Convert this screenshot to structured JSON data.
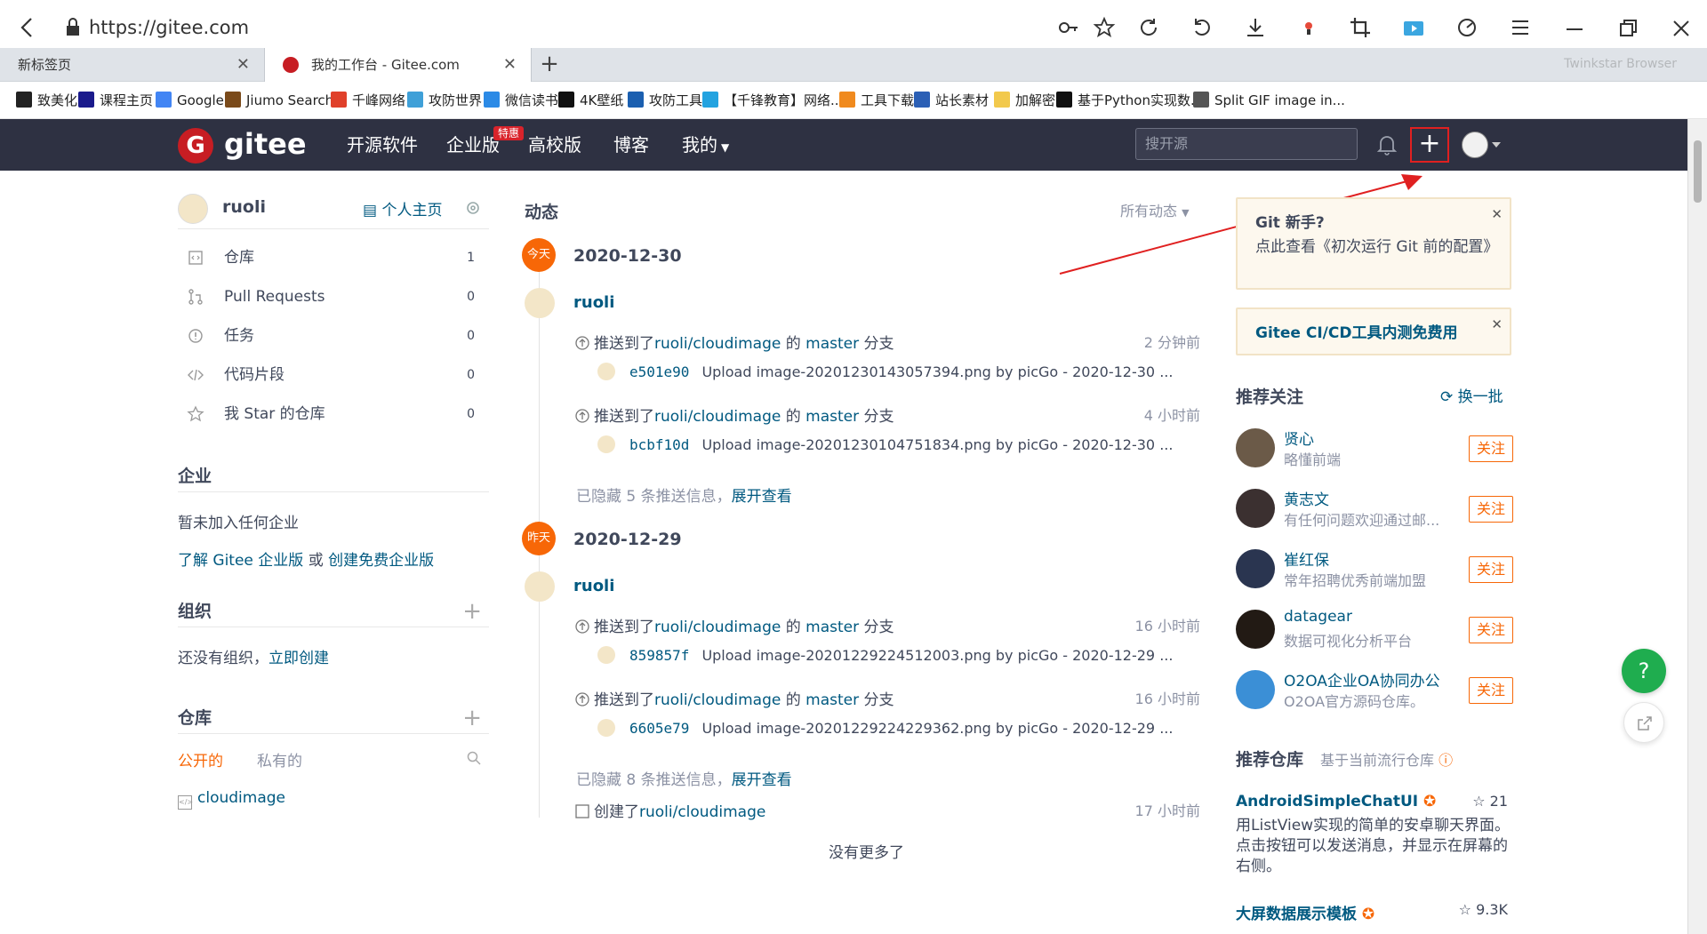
{
  "browser": {
    "url": "https://gitee.com",
    "brand": "Twinkstar Browser",
    "tabs": [
      {
        "label": "新标签页",
        "active": false
      },
      {
        "label": "我的工作台 - Gitee.com",
        "active": true
      }
    ],
    "bookmarks": [
      {
        "label": "致美化",
        "icon": "x-icon",
        "color": "#222"
      },
      {
        "label": "课程主页",
        "icon": "wh-icon",
        "color": "#1a1a8c"
      },
      {
        "label": "Google",
        "icon": "google-icon",
        "color": "#4285f4"
      },
      {
        "label": "Jiumo Search",
        "icon": "j-icon",
        "color": "#7a4a1a"
      },
      {
        "label": "千峰网络",
        "icon": "c-icon",
        "color": "#e0402a"
      },
      {
        "label": "攻防世界",
        "icon": "globe-icon",
        "color": "#3fa0d8"
      },
      {
        "label": "微信读书",
        "icon": "book-icon",
        "color": "#2b8ae6"
      },
      {
        "label": "4K壁纸",
        "icon": "4k-icon",
        "color": "#111"
      },
      {
        "label": "攻防工具",
        "icon": "shield-icon",
        "color": "#1b5fb0"
      },
      {
        "label": "【千锋教育】网络...",
        "icon": "tv-icon",
        "color": "#23a3e0"
      },
      {
        "label": "工具下载",
        "icon": "tool-icon",
        "color": "#f08a1e"
      },
      {
        "label": "站长素材",
        "icon": "flag-icon",
        "color": "#2b5fb5"
      },
      {
        "label": "加解密",
        "icon": "folder-icon",
        "color": "#f2c94c"
      },
      {
        "label": "基于Python实现数...",
        "icon": "fs-icon",
        "color": "#111"
      },
      {
        "label": "Split GIF image in...",
        "icon": "gif-icon",
        "color": "#555"
      }
    ]
  },
  "gitee": {
    "logo": "gitee",
    "logo_letter": "G",
    "nav": [
      "开源软件",
      "企业版",
      "高校版",
      "博客",
      "我的"
    ],
    "badge": "特惠",
    "search_placeholder": "搜开源",
    "plus": "+"
  },
  "left": {
    "username": "ruoli",
    "homepage": "个人主页",
    "nav": [
      {
        "label": "仓库",
        "count": "1"
      },
      {
        "label": "Pull Requests",
        "count": "0"
      },
      {
        "label": "任务",
        "count": "0"
      },
      {
        "label": "代码片段",
        "count": "0"
      },
      {
        "label": "我 Star 的仓库",
        "count": "0"
      }
    ],
    "enterprise_title": "企业",
    "enterprise_none": "暂未加入任何企业",
    "enterprise_learn": "了解 Gitee 企业版",
    "enterprise_or": "或",
    "enterprise_create": "创建免费企业版",
    "org_title": "组织",
    "org_none": "还没有组织，",
    "org_create": "立即创建",
    "repo_title": "仓库",
    "repo_tab_public": "公开的",
    "repo_tab_private": "私有的",
    "repo_item": "cloudimage"
  },
  "feed": {
    "title": "动态",
    "filter": "所有动态",
    "days": [
      {
        "badge": "今天",
        "date": "2020-12-30",
        "user": "ruoli",
        "events": [
          {
            "verb": "推送到了",
            "repo": "ruoli/cloudimage",
            "of": "的",
            "branch": "master",
            "tail": "分支",
            "time": "2 分钟前",
            "sha": "e501e90",
            "msg": "Upload image-20201230143057394.png by picGo - 2020-12-30 ..."
          },
          {
            "verb": "推送到了",
            "repo": "ruoli/cloudimage",
            "of": "的",
            "branch": "master",
            "tail": "分支",
            "time": "4 小时前",
            "sha": "bcbf10d",
            "msg": "Upload image-20201230104751834.png by picGo - 2020-12-30 ..."
          }
        ],
        "hidden": "已隐藏 5 条推送信息，",
        "expand": "展开查看"
      },
      {
        "badge": "昨天",
        "date": "2020-12-29",
        "user": "ruoli",
        "events": [
          {
            "verb": "推送到了",
            "repo": "ruoli/cloudimage",
            "of": "的",
            "branch": "master",
            "tail": "分支",
            "time": "16 小时前",
            "sha": "859857f",
            "msg": "Upload image-20201229224512003.png by picGo - 2020-12-29 ..."
          },
          {
            "verb": "推送到了",
            "repo": "ruoli/cloudimage",
            "of": "的",
            "branch": "master",
            "tail": "分支",
            "time": "16 小时前",
            "sha": "6605e79",
            "msg": "Upload image-20201229224229362.png by picGo - 2020-12-29 ..."
          }
        ],
        "hidden": "已隐藏 8 条推送信息，",
        "expand": "展开查看",
        "created_verb": "创建了",
        "created_repo": "ruoli/cloudimage",
        "created_time": "17 小时前"
      }
    ],
    "no_more": "没有更多了"
  },
  "right": {
    "tip1_title": "Git 新手?",
    "tip1_desc": "点此查看《初次运行 Git 前的配置》",
    "tip2": "Gitee CI/CD工具内测免费用",
    "rec_title": "推荐关注",
    "rec_refresh": "换一批",
    "follow_label": "关注",
    "users": [
      {
        "name": "贤心",
        "desc": "略懂前端",
        "color": "#6b5a48"
      },
      {
        "name": "黄志文",
        "desc": "有任何问题欢迎通过邮...",
        "color": "#3b3030"
      },
      {
        "name": "崔红保",
        "desc": "常年招聘优秀前端加盟",
        "color": "#2a3550"
      },
      {
        "name": "datagear",
        "desc": "数据可视化分析平台",
        "color": "#221a14"
      },
      {
        "name": "O2OA企业OA协同办公",
        "desc": "O2OA官方源码仓库。",
        "color": "#3b8fd6"
      }
    ],
    "repo_title": "推荐仓库",
    "repo_sub": "基于当前流行仓库",
    "repos": [
      {
        "name": "AndroidSimpleChatUI",
        "stars": "21",
        "desc": "用ListView实现的简单的安卓聊天界面。点击按钮可以发送消息，并显示在屏幕的右侧。"
      },
      {
        "name": "大屏数据展示模板",
        "stars": "9.3K",
        "desc": ""
      }
    ]
  },
  "help": "?"
}
